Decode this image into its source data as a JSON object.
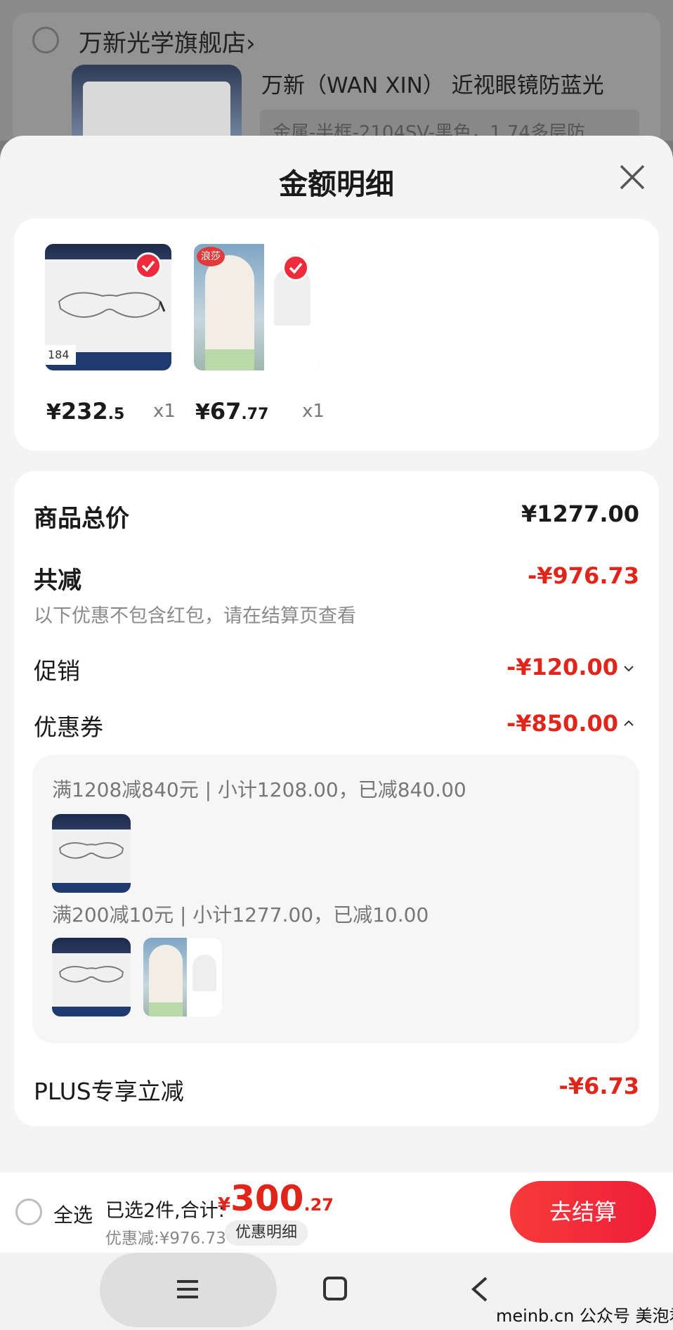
{
  "background": {
    "store_name": "万新光学旗舰店",
    "store_chevron": "›",
    "product_title": "万新（WAN XIN） 近视眼镜防蓝光",
    "sku": "金属-半框-2104SV-黑色，1.74多层防"
  },
  "sheet": {
    "title": "金额明细",
    "close_icon": "close-icon"
  },
  "products": [
    {
      "image": "glasses",
      "price_symbol": "¥",
      "price_int": "232",
      "price_dec": ".5",
      "qty": "x1",
      "tag": "184",
      "checked": true
    },
    {
      "image": "sun-hoodie",
      "price_symbol": "¥",
      "price_int": "67",
      "price_dec": ".77",
      "qty": "x1",
      "badge": "浪莎",
      "checked": true
    }
  ],
  "detail": {
    "total_label": "商品总价",
    "total_value": "¥1277.00",
    "reduce_label": "共减",
    "reduce_value": "-¥976.73",
    "note": "以下优惠不包含红包，请在结算页查看",
    "promo_label": "促销",
    "promo_value": "-¥120.00",
    "coupon_label": "优惠券",
    "coupon_value": "-¥850.00",
    "coupons": [
      {
        "text": "满1208减840元 | 小计1208.00，已减840.00"
      },
      {
        "text": "满200减10元 | 小计1277.00，已减10.00"
      }
    ],
    "plus_label": "PLUS专享立减",
    "plus_value": "-¥6.73"
  },
  "bottom": {
    "select_all": "全选",
    "selected_summary": "已选2件,合计:",
    "total_symbol": "¥",
    "total_int": "300",
    "total_dec": ".27",
    "discount_text": "优惠减:¥976.73",
    "detail_chip": "优惠明细",
    "checkout": "去结算"
  },
  "watermark": "meinb.cn 公众号 美泡君",
  "colors": {
    "accent_red": "#e1251b",
    "button_red": "#f0243a"
  }
}
